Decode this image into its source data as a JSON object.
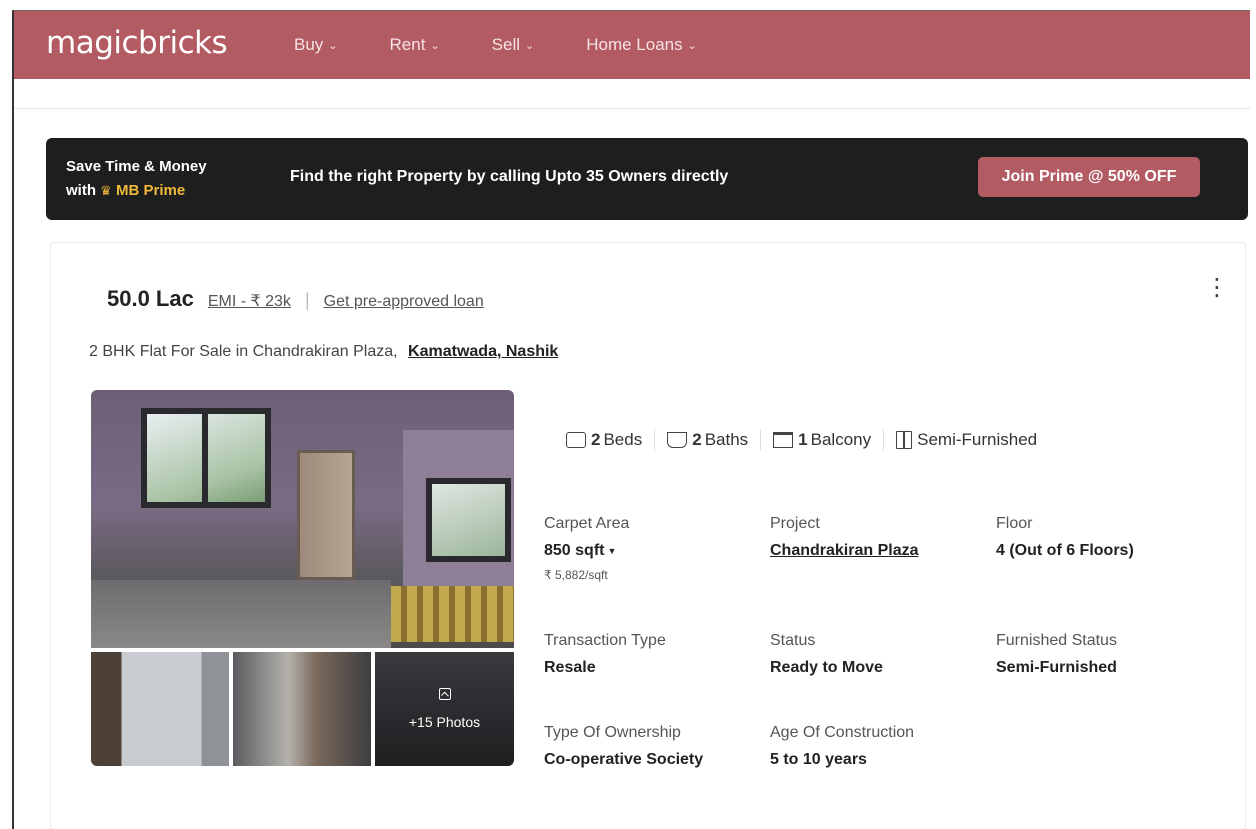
{
  "header": {
    "logo": "magicbricks",
    "nav": [
      {
        "label": "Buy"
      },
      {
        "label": "Rent"
      },
      {
        "label": "Sell"
      },
      {
        "label": "Home Loans"
      }
    ],
    "brand_color": "#b35b62"
  },
  "prime_banner": {
    "line1": "Save Time & Money",
    "line2_prefix": "with",
    "line2_brand": "MB Prime",
    "message": "Find the right Property by calling Upto 35 Owners directly",
    "button": "Join Prime @ 50% OFF"
  },
  "listing": {
    "price": "50.0 Lac",
    "emi": "EMI - ₹ 23k",
    "loan_link": "Get pre-approved loan",
    "title_prefix": "2 BHK Flat For Sale in Chandrakiran Plaza,",
    "title_locality": "Kamatwada, Nashik",
    "photos_more": "+15 Photos",
    "amenities": [
      {
        "value": "2",
        "label": "Beds",
        "icon": "bed-icon"
      },
      {
        "value": "2",
        "label": "Baths",
        "icon": "bath-icon"
      },
      {
        "value": "1",
        "label": "Balcony",
        "icon": "balcony-icon"
      },
      {
        "value": "",
        "label": "Semi-Furnished",
        "icon": "furnishing-icon"
      }
    ],
    "summary": {
      "carpet_area_label": "Carpet Area",
      "carpet_area_value": "850 sqft",
      "carpet_area_rate": "₹ 5,882/sqft",
      "project_label": "Project",
      "project_value": "Chandrakiran Plaza",
      "floor_label": "Floor",
      "floor_value": "4 (Out of 6 Floors)",
      "transaction_label": "Transaction Type",
      "transaction_value": "Resale",
      "status_label": "Status",
      "status_value": "Ready to Move",
      "furnished_label": "Furnished Status",
      "furnished_value": "Semi-Furnished",
      "ownership_label": "Type Of Ownership",
      "ownership_value": "Co-operative Society",
      "age_label": "Age Of Construction",
      "age_value": "5 to 10 years"
    }
  }
}
